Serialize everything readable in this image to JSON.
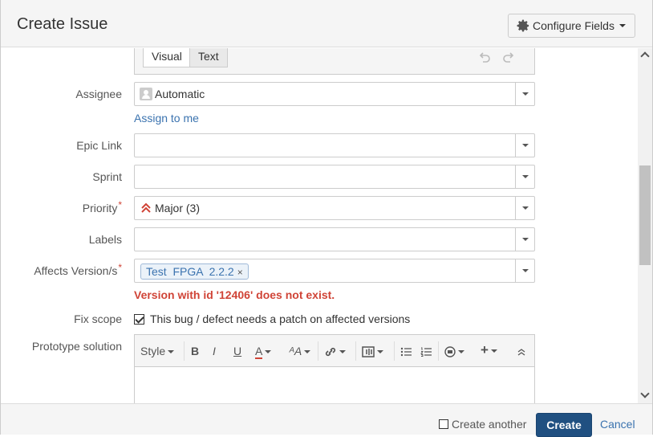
{
  "dialog": {
    "title": "Create Issue",
    "configure_fields_label": "Configure Fields"
  },
  "editor": {
    "tab_visual": "Visual",
    "tab_text": "Text"
  },
  "fields": {
    "assignee": {
      "label": "Assignee",
      "value": "Automatic",
      "assign_to_me": "Assign to me"
    },
    "epic_link": {
      "label": "Epic Link",
      "value": ""
    },
    "sprint": {
      "label": "Sprint",
      "value": ""
    },
    "priority": {
      "label": "Priority",
      "required_mark": "*",
      "value": "Major (3)",
      "icon_color": "#d04437"
    },
    "labels": {
      "label": "Labels",
      "value": ""
    },
    "affects_versions": {
      "label": "Affects Version/s",
      "required_mark": "*",
      "chip": "Test  FPGA  2.2.2",
      "chip_remove": "×",
      "error": "Version with id '12406' does not exist."
    },
    "fix_scope": {
      "label": "Fix scope",
      "checkbox_label": "This bug / defect needs a patch on affected versions",
      "checked": true
    },
    "prototype_solution": {
      "label": "Prototype solution"
    }
  },
  "toolbar": {
    "style": "Style",
    "bold": "B",
    "italic": "I",
    "underline": "U",
    "text_color": "A",
    "text_effects": "ᴬA"
  },
  "footer": {
    "create_another": "Create another",
    "create": "Create",
    "cancel": "Cancel"
  },
  "colors": {
    "primary": "#205081",
    "link": "#3b73af",
    "error": "#d04437"
  }
}
